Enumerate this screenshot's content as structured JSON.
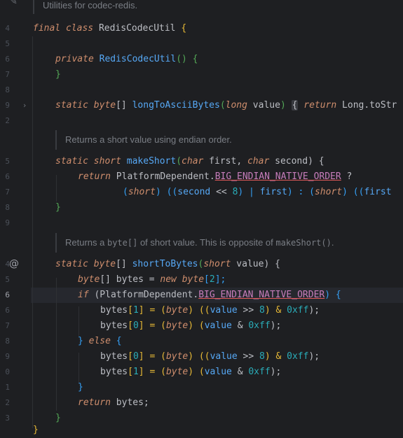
{
  "gutter": {
    "line_numbers": [
      "4",
      "5",
      "6",
      "7",
      "8",
      "9",
      "2",
      "5",
      "6",
      "7",
      "8",
      "9",
      "0",
      "3",
      "4",
      "5",
      "6",
      "7",
      "8",
      "9",
      "0",
      "1",
      "2",
      "3"
    ],
    "current_line": "6",
    "icons": {
      "edit": "pencil-icon",
      "fold": "chevron-right-icon",
      "override": "at-icon"
    }
  },
  "doc": {
    "class_doc": "Utilities for codec-redis.",
    "make_short_doc": "Returns a short value using endian order.",
    "to_bytes_doc_prefix": "Returns a ",
    "to_bytes_doc_code1": "byte[]",
    "to_bytes_doc_mid": " of short value. This is opposite of ",
    "to_bytes_doc_code2": "makeShort()",
    "to_bytes_doc_suffix": "."
  },
  "code": {
    "l1_kw1": "final",
    "l1_kw2": "class",
    "l1_name": "RedisCodecUtil",
    "l1_brace": "{",
    "l2_kw": "private",
    "l2_name": "RedisCodecUtil",
    "l2_rest": "() {",
    "l3": "}",
    "l4_kw": "static",
    "l4_type": "byte",
    "l4_arr": "[] ",
    "l4_name": "longToAsciiBytes",
    "l4_p1": "(",
    "l4_type2": "long",
    "l4_param": " value",
    "l4_p2": ") ",
    "l4_fold": "{",
    "l4_kw2": " return",
    "l4_tail": " Long.toStr",
    "l5_kw": "static",
    "l5_type": "short",
    "l5_name": "makeShort",
    "l5_p1": "(",
    "l5_t1": "char",
    "l5_a1": " first, ",
    "l5_t2": "char",
    "l5_a2": " second) {",
    "l6_kw": "return",
    "l6_cls": " PlatformDependent.",
    "l6_const": "BIG_ENDIAN_NATIVE_ORDER",
    "l6_tail": " ?",
    "l7_a": "(",
    "l7_t": "short",
    "l7_b": ") ((",
    "l7_v": "second",
    "l7_c": " << ",
    "l7_n": "8",
    "l7_d": ") | ",
    "l7_v2": "first",
    "l7_e": ") : (",
    "l7_t2": "short",
    "l7_f": ") ((",
    "l7_v3": "first",
    "l8": "}",
    "m1_kw": "static",
    "m1_type": "byte",
    "m1_arr": "[] ",
    "m1_name": "shortToBytes",
    "m1_p1": "(",
    "m1_t": "short",
    "m1_a": " value) {",
    "m2_type": "byte",
    "m2_rest1": "[] bytes = ",
    "m2_kw": "new",
    "m2_type2": " byte",
    "m2_rest2": "[",
    "m2_num": "2",
    "m2_rest3": "];",
    "m3_kw": "if",
    "m3_a": " (PlatformDependent.",
    "m3_const": "BIG_ENDIAN_NATIVE_ORDER",
    "m3_b": ") {",
    "a1_var": "bytes",
    "a1_a": "[",
    "a1_idx": "1",
    "a1_b": "] = (",
    "a1_t": "byte",
    "a1_c": ") ((",
    "a1_v": "value",
    "a1_d": " >> ",
    "a1_n": "8",
    "a1_e": ") & ",
    "a1_h": "0xff",
    "a1_f": ");",
    "a2_var": "bytes",
    "a2_a": "[",
    "a2_idx": "0",
    "a2_b": "] = (",
    "a2_t": "byte",
    "a2_c": ") (",
    "a2_v": "value",
    "a2_e": " & ",
    "a2_h": "0xff",
    "a2_f": ");",
    "else_a": "} ",
    "else_kw": "else",
    "else_b": " {",
    "b1_var": "bytes",
    "b1_a": "[",
    "b1_idx": "0",
    "b1_b": "] = (",
    "b1_t": "byte",
    "b1_c": ") ((",
    "b1_v": "value",
    "b1_d": " >> ",
    "b1_n": "8",
    "b1_e": ") & ",
    "b1_h": "0xff",
    "b1_f": ");",
    "b2_var": "bytes",
    "b2_a": "[",
    "b2_idx": "1",
    "b2_b": "] = (",
    "b2_t": "byte",
    "b2_c": ") (",
    "b2_v": "value",
    "b2_e": " & ",
    "b2_h": "0xff",
    "b2_f": ");",
    "close_if": "}",
    "ret_kw": "return",
    "ret_rest": " bytes;",
    "close_m": "}",
    "close_c": "}"
  }
}
